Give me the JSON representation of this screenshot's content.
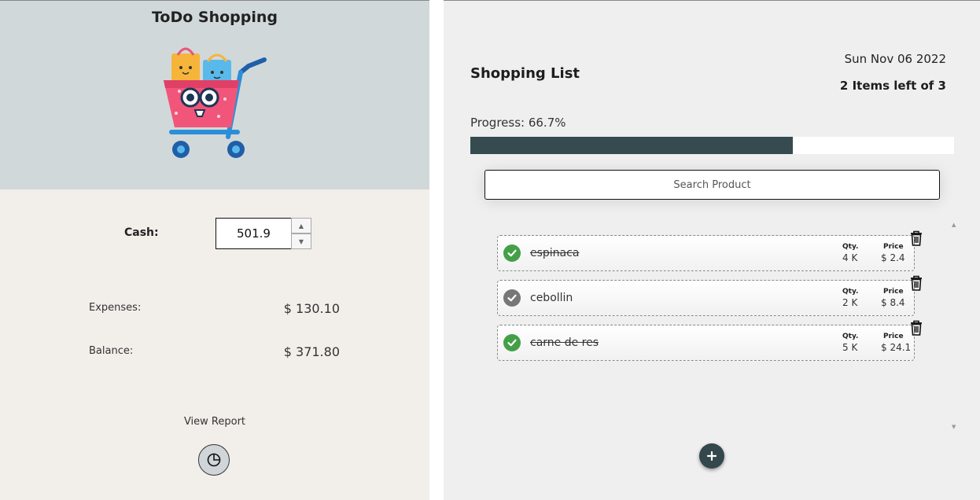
{
  "app": {
    "title": "ToDo Shopping"
  },
  "wallet": {
    "cash_label": "Cash:",
    "cash_value": "501.9",
    "expenses_label": "Expenses:",
    "expenses_value": "$ 130.10",
    "balance_label": "Balance:",
    "balance_value": "$ 371.80",
    "report_label": "View Report"
  },
  "list": {
    "title": "Shopping List",
    "date": "Sun Nov 06 2022",
    "items_left": "2 Items left of 3",
    "progress_label": "Progress: 66.7%",
    "progress_fraction": 0.667,
    "search_placeholder": "Search Product",
    "qty_heading": "Qty.",
    "price_heading": "Price",
    "items": [
      {
        "name": "espinaca",
        "qty": "4 K",
        "price": "$ 2.4",
        "done": true
      },
      {
        "name": "cebollin",
        "qty": "2 K",
        "price": "$ 8.4",
        "done": false
      },
      {
        "name": "carne de res",
        "qty": "5 K",
        "price": "$ 24.1",
        "done": true
      }
    ]
  },
  "colors": {
    "accent_dark": "#354b50",
    "check_done": "#43a047",
    "check_pending": "#777777",
    "header_bg": "#d1d8da",
    "panel_bg": "#f2eeea"
  },
  "icons": {
    "report": "pie-chart-icon",
    "delete": "trash-icon",
    "add": "plus-icon",
    "check": "check-circle-icon"
  }
}
